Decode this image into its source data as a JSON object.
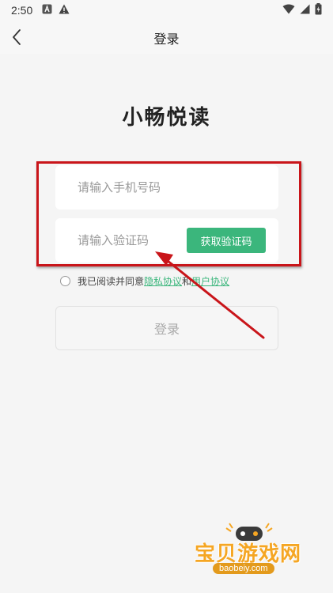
{
  "status_bar": {
    "time": "2:50",
    "icons": [
      "notification-a-icon",
      "warning-icon",
      "wifi-icon",
      "cellular-icon",
      "battery-icon"
    ]
  },
  "app_bar": {
    "title": "登录",
    "back_icon": "chevron-left-icon"
  },
  "brand": {
    "name": "小畅悦读"
  },
  "form": {
    "phone_placeholder": "请输入手机号码",
    "code_placeholder": "请输入验证码",
    "get_code_label": "获取验证码",
    "agree_prefix": "我已阅读并同意",
    "privacy_link": "隐私协议",
    "and_text": "和",
    "user_link": "用户协议",
    "login_label": "登录"
  },
  "annotation": {
    "highlight_color": "#c9151a"
  },
  "watermark": {
    "text": "宝贝游戏网",
    "url": "baobeiy.com"
  },
  "colors": {
    "accent": "#3bb67c",
    "background": "#f5f5f5"
  }
}
